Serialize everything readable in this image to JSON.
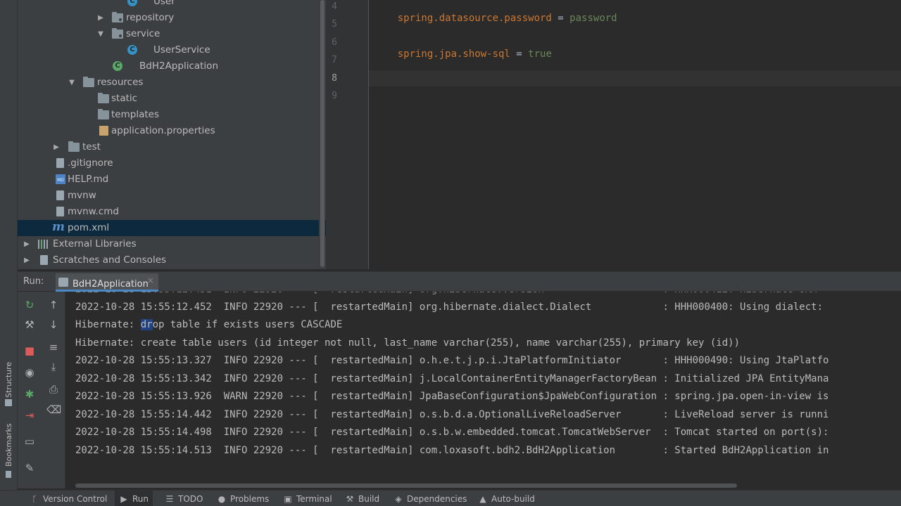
{
  "side_strip": {
    "structure_label": "Structure",
    "bookmarks_label": "Bookmarks"
  },
  "project_tree": {
    "items": [
      {
        "label": "User",
        "kind": "class"
      },
      {
        "label": "repository",
        "kind": "package"
      },
      {
        "label": "service",
        "kind": "package"
      },
      {
        "label": "UserService",
        "kind": "class"
      },
      {
        "label": "BdH2Application",
        "kind": "spring-class"
      },
      {
        "label": "resources",
        "kind": "folder"
      },
      {
        "label": "static",
        "kind": "folder"
      },
      {
        "label": "templates",
        "kind": "folder"
      },
      {
        "label": "application.properties",
        "kind": "properties"
      },
      {
        "label": "test",
        "kind": "folder"
      },
      {
        "label": ".gitignore",
        "kind": "file"
      },
      {
        "label": "HELP.md",
        "kind": "markdown"
      },
      {
        "label": "mvnw",
        "kind": "file"
      },
      {
        "label": "mvnw.cmd",
        "kind": "file"
      },
      {
        "label": "pom.xml",
        "kind": "maven"
      },
      {
        "label": "External Libraries",
        "kind": "libraries"
      },
      {
        "label": "Scratches and Consoles",
        "kind": "scratches"
      }
    ],
    "md_badge": "MD",
    "maven_badge": "m",
    "class_badge": "C"
  },
  "editor": {
    "line_numbers": [
      "4",
      "5",
      "6",
      "7",
      "8",
      "9"
    ],
    "lines": [
      {
        "key": "spring.datasource.password",
        "eq": " = ",
        "value": "password"
      },
      {
        "key": "spring.jpa.show-sql",
        "eq": " = ",
        "value": "true"
      }
    ]
  },
  "run_panel": {
    "label": "Run:",
    "tab_label": "BdH2Application",
    "tab_close": "×",
    "log_lines": [
      "2022-10-28 15:55:12.452  INFO 22920 --- [  restartedMain] org.hibernate.dialect.Dialect            : HHH000400: Using dialect: ",
      "Hibernate: ",
      "dr",
      "op table if exists users CASCADE",
      "Hibernate: create table users (id integer not null, last_name varchar(255), name varchar(255), primary key (id))",
      "2022-10-28 15:55:13.327  INFO 22920 --- [  restartedMain] o.h.e.t.j.p.i.JtaPlatformInitiator       : HHH000490: Using JtaPlatfo",
      "2022-10-28 15:55:13.342  INFO 22920 --- [  restartedMain] j.LocalContainerEntityManagerFactoryBean : Initialized JPA EntityMana",
      "2022-10-28 15:55:13.926  WARN 22920 --- [  restartedMain] JpaBaseConfiguration$JpaWebConfiguration : spring.jpa.open-in-view is",
      "2022-10-28 15:55:14.442  INFO 22920 --- [  restartedMain] o.s.b.d.a.OptionalLiveReloadServer       : LiveReload server is runni",
      "2022-10-28 15:55:14.498  INFO 22920 --- [  restartedMain] o.s.b.w.embedded.tomcat.TomcatWebServer  : Tomcat started on port(s):",
      "2022-10-28 15:55:14.513  INFO 22920 --- [  restartedMain] com.loxasoft.bdh2.BdH2Application        : Started BdH2Application in"
    ]
  },
  "bottom_bar": {
    "items": [
      {
        "label": "Version Control",
        "icon": "branch-icon"
      },
      {
        "label": "Run",
        "icon": "play-icon"
      },
      {
        "label": "TODO",
        "icon": "list-icon"
      },
      {
        "label": "Problems",
        "icon": "info-icon"
      },
      {
        "label": "Terminal",
        "icon": "terminal-icon"
      },
      {
        "label": "Build",
        "icon": "hammer-icon"
      },
      {
        "label": "Dependencies",
        "icon": "layers-icon"
      },
      {
        "label": "Auto-build",
        "icon": "warning-icon"
      }
    ]
  }
}
